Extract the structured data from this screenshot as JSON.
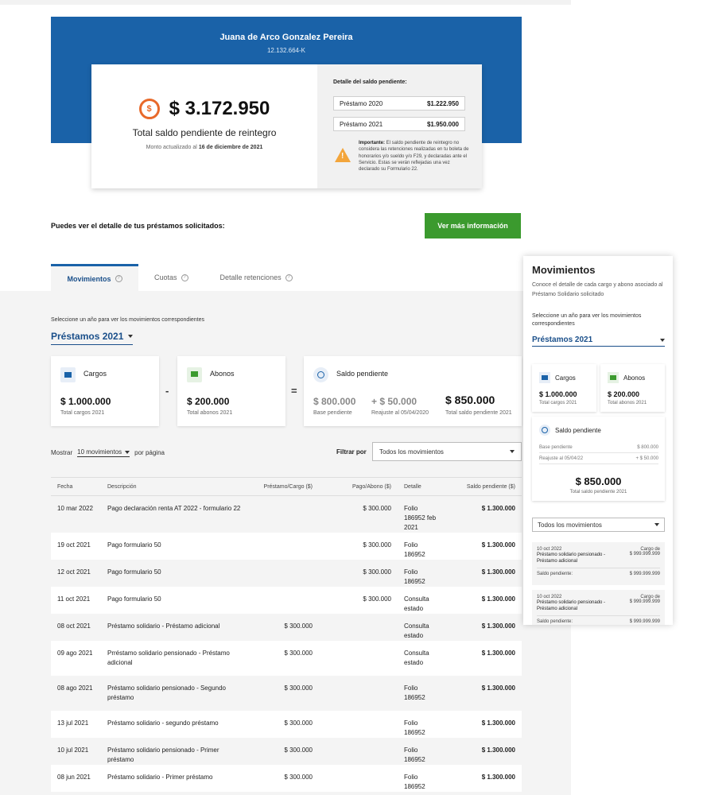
{
  "hero": {
    "name": "Juana de Arco Gonzalez Pereira",
    "rut": "12.132.664-K"
  },
  "summary": {
    "amount": "$ 3.172.950",
    "label": "Total saldo pendiente de reintegro",
    "updated_prefix": "Monto actualizado al",
    "updated_date": "16 de diciembre de 2021",
    "detail_title": "Detalle del saldo pendiente:",
    "loans": [
      {
        "label": "Préstamo 2020",
        "value": "$1.222.950"
      },
      {
        "label": "Préstamo 2021",
        "value": "$1.950.000"
      }
    ],
    "warning_bold": "Importante:",
    "warning_text": "El saldo pendiente de reintegro no considera las retenciones realizadas en tu boleta de honorarios y/o sueldo y/o F29, y declaradas ante el Servicio. Estas se verán reflejadas una vez declarado su Formulario 22."
  },
  "cta": {
    "text": "Puedes ver el detalle de tus préstamos solicitados:",
    "button": "Ver más información"
  },
  "tabs": [
    {
      "label": "Movimientos"
    },
    {
      "label": "Cuotas"
    },
    {
      "label": "Detalle retenciones"
    }
  ],
  "tab_help_glyph": "?",
  "movements": {
    "select_label": "Seleccione un año para ver los movimientos correspondientes",
    "year": "Préstamos 2021",
    "cargos": {
      "title": "Cargos",
      "value": "$ 1.000.000",
      "sub": "Total cargos 2021"
    },
    "abonos": {
      "title": "Abonos",
      "value": "$ 200.000",
      "sub": "Total abonos 2021"
    },
    "saldo": {
      "title": "Saldo pendiente",
      "base_value": "$ 800.000",
      "base_sub": "Base pendiente",
      "reajuste_value": "+ $ 50.000",
      "reajuste_sub": "Reajuste al 05/04/2020",
      "total_value": "$ 850.000",
      "total_sub": "Total saldo pendiente 2021"
    },
    "op_minus": "-",
    "op_equals": "=",
    "show_prefix": "Mostrar",
    "show_value": "10 movimientos",
    "show_suffix": "por página",
    "filter_label": "Filtrar por",
    "filter_value": "Todos los movimientos"
  },
  "table": {
    "headers": [
      "Fecha",
      "Descripción",
      "Préstamo/Cargo ($)",
      "Pago/Abono ($)",
      "Detalle",
      "Saldo pendiente ($)"
    ],
    "rows": [
      [
        "10 mar 2022",
        "Pago declaración renta AT 2022 - formulario 22",
        "",
        "$ 300.000",
        "Folio 186952 feb 2021",
        "$ 1.300.000"
      ],
      [
        "19 oct 2021",
        "Pago formulario 50",
        "",
        "$ 300.000",
        "Folio 186952",
        "$ 1.300.000"
      ],
      [
        "12 oct 2021",
        "Pago formulario 50",
        "",
        "$ 300.000",
        "Folio 186952",
        "$ 1.300.000"
      ],
      [
        "11 oct 2021",
        "Pago formulario 50",
        "",
        "$ 300.000",
        "Consulta estado",
        "$ 1.300.000"
      ],
      [
        "08 oct 2021",
        "Préstamo solidario - Préstamo adicional",
        "$ 300.000",
        "",
        "Consulta estado",
        "$ 1.300.000"
      ],
      [
        "09 ago 2021",
        "Prréstamo solidario pensionado - Préstamo adicional",
        "$ 300.000",
        "",
        "Consulta estado",
        "$ 1.300.000"
      ],
      [
        "08 ago 2021",
        "Préstamo solidario pensionado - Segundo préstamo",
        "$ 300.000",
        "",
        "Folio 186952",
        "$ 1.300.000"
      ],
      [
        "13 jul 2021",
        "Préstamo solidario - segundo préstamo",
        "$ 300.000",
        "",
        "Folio 186952",
        "$ 1.300.000"
      ],
      [
        "10 jul 2021",
        "Préstamo solidario pensionado - Primer préstamo",
        "$ 300.000",
        "",
        "Folio 186952",
        "$ 1.300.000"
      ],
      [
        "08 jun 2021",
        "Préstamo solidario - Primer préstamo",
        "$ 300.000",
        "",
        "Folio 186952",
        "$ 1.300.000"
      ]
    ]
  },
  "mobile": {
    "title": "Movimientos",
    "desc": "Conoce el detalle de cada cargo y abono asociado al Préstamo Solidario solicitado",
    "select_label": "Seleccione un año para ver los movimientos correspondientes",
    "year": "Préstamos 2021",
    "cargos": {
      "title": "Cargos",
      "value": "$ 1.000.000",
      "sub": "Total cargos 2021"
    },
    "abonos": {
      "title": "Abonos",
      "value": "$ 200.000",
      "sub": "Total abonos 2021"
    },
    "saldo": {
      "title": "Saldo pendiente",
      "base_label": "Base pendiente",
      "base_value": "$ 800.000",
      "reajuste_label": "Reajuste al 05/04/22",
      "reajuste_value": "+ $ 50.000",
      "total_value": "$ 850.000",
      "total_sub": "Total saldo pendiente 2021"
    },
    "filter_value": "Todos los movimientos",
    "items": [
      {
        "date": "10 oct 2022",
        "type": "Cargo de",
        "desc": "Préstamo solidario pensionado - Préstamo adicional",
        "amount": "$ 999.999.999",
        "saldo_label": "Saldo pendiente:",
        "saldo_value": "$ 999.999.999"
      },
      {
        "date": "10 oct 2022",
        "type": "Cargo de",
        "desc": "Préstamo solidario pensionado - Préstamo adicional",
        "amount": "$ 999.999.999",
        "saldo_label": "Saldo pendiente:",
        "saldo_value": "$ 999.999.999"
      }
    ]
  }
}
